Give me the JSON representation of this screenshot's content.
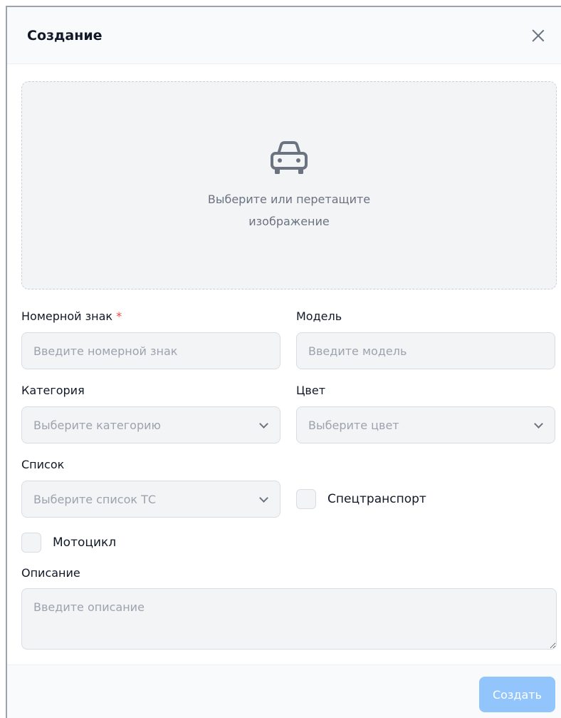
{
  "dialog": {
    "title": "Создание"
  },
  "dropzone": {
    "text": "Выберите или перетащите изображение"
  },
  "plate": {
    "label": "Номерной знак",
    "required_mark": "*",
    "placeholder": "Введите номерной знак"
  },
  "model": {
    "label": "Модель",
    "placeholder": "Введите модель"
  },
  "category": {
    "label": "Категория",
    "placeholder": "Выберите категорию"
  },
  "color": {
    "label": "Цвет",
    "placeholder": "Выберите цвет"
  },
  "list": {
    "label": "Список",
    "placeholder": "Выберите список ТС"
  },
  "special_transport": {
    "label": "Спецтранспорт",
    "checked": false
  },
  "motorcycle": {
    "label": "Мотоцикл",
    "checked": false
  },
  "description": {
    "label": "Описание",
    "placeholder": "Введите описание"
  },
  "footer": {
    "create_label": "Создать"
  },
  "colors": {
    "accent_disabled": "#93c5fd",
    "required": "#ef4444"
  },
  "icons": {
    "dropzone": "car-icon",
    "close": "close-icon",
    "dropdown": "chevron-down-icon"
  }
}
